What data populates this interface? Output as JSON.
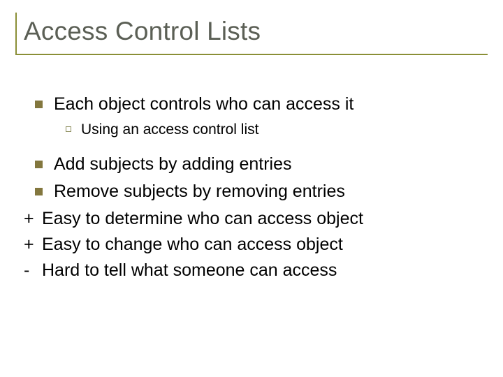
{
  "title": "Access Control Lists",
  "bullets": {
    "b1": "Each object controls who can access it",
    "b1_sub": "Using an access control list",
    "b2": "Add subjects by adding entries",
    "b3": "Remove subjects by removing entries"
  },
  "lines": {
    "plus1_prefix": "+",
    "plus1_text": "Easy to determine who can access object",
    "plus2_prefix": "+",
    "plus2_text": "Easy to change who can access object",
    "minus_prefix": "-",
    "minus_text": "Hard to tell what someone can access"
  }
}
